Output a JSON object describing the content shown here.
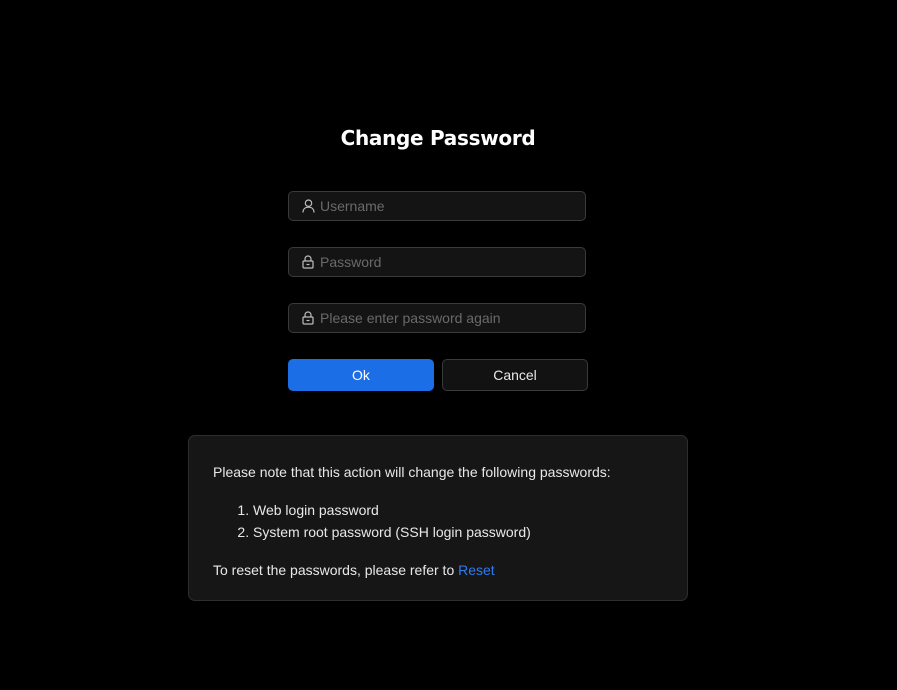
{
  "title": "Change Password",
  "form": {
    "username_placeholder": "Username",
    "password_placeholder": "Password",
    "password_again_placeholder": "Please enter password again",
    "ok_label": "Ok",
    "cancel_label": "Cancel"
  },
  "notice": {
    "intro": "Please note that this action will change the following passwords:",
    "items": [
      "Web login password",
      "System root password (SSH login password)"
    ],
    "reset_text": "To reset the passwords, please refer to ",
    "reset_link": "Reset"
  },
  "colors": {
    "background": "#000000",
    "primary": "#1b6ee6",
    "link": "#2f7bf0",
    "panel": "#161616"
  },
  "icons": {
    "username": "user-icon",
    "password": "lock-icon",
    "password_again": "lock-icon"
  }
}
